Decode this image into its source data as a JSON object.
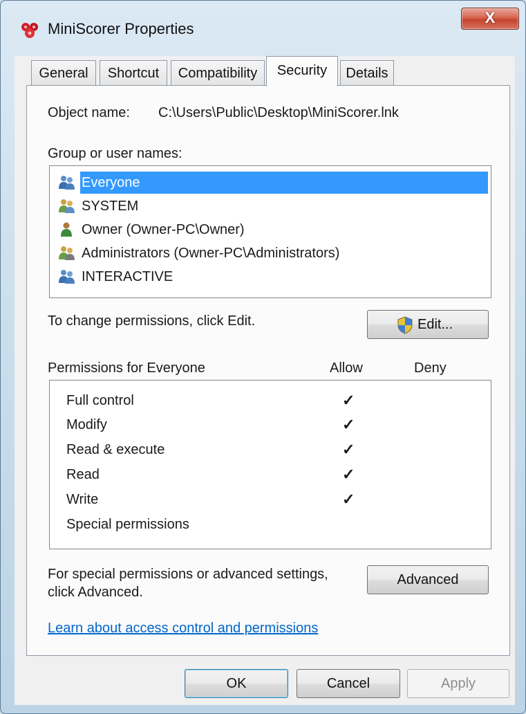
{
  "window": {
    "title": "MiniScorer Properties",
    "close_glyph": "X",
    "icon": "app-icon"
  },
  "tabs": [
    {
      "label": "General"
    },
    {
      "label": "Shortcut"
    },
    {
      "label": "Compatibility"
    },
    {
      "label": "Security",
      "active": true
    },
    {
      "label": "Details"
    }
  ],
  "object": {
    "label": "Object name:",
    "value": "C:\\Users\\Public\\Desktop\\MiniScorer.lnk"
  },
  "groups": {
    "label": "Group or user names:",
    "items": [
      {
        "label": "Everyone",
        "icon": "users-icon",
        "selected": true
      },
      {
        "label": "SYSTEM",
        "icon": "users-icon"
      },
      {
        "label": "Owner (Owner-PC\\Owner)",
        "icon": "user-icon"
      },
      {
        "label": "Administrators (Owner-PC\\Administrators)",
        "icon": "users-icon"
      },
      {
        "label": "INTERACTIVE",
        "icon": "users-icon"
      }
    ]
  },
  "change_text": "To change permissions, click Edit.",
  "edit_button": {
    "label": "Edit...",
    "icon": "shield-icon"
  },
  "permissions": {
    "header": "Permissions for Everyone",
    "allow_label": "Allow",
    "deny_label": "Deny",
    "check_glyph": "✓",
    "rows": [
      {
        "label": "Full control",
        "allow": true,
        "deny": false
      },
      {
        "label": "Modify",
        "allow": true,
        "deny": false
      },
      {
        "label": "Read & execute",
        "allow": true,
        "deny": false
      },
      {
        "label": "Read",
        "allow": true,
        "deny": false
      },
      {
        "label": "Write",
        "allow": true,
        "deny": false
      },
      {
        "label": "Special permissions",
        "allow": false,
        "deny": false
      }
    ]
  },
  "advanced": {
    "text_line1": "For special permissions or advanced settings,",
    "text_line2": "click Advanced.",
    "button": "Advanced"
  },
  "link": "Learn about access control and permissions",
  "footer": {
    "ok": "OK",
    "cancel": "Cancel",
    "apply": "Apply"
  },
  "colors": {
    "selection": "#3399ff",
    "link": "#0066cc",
    "close": "#c4452d"
  }
}
